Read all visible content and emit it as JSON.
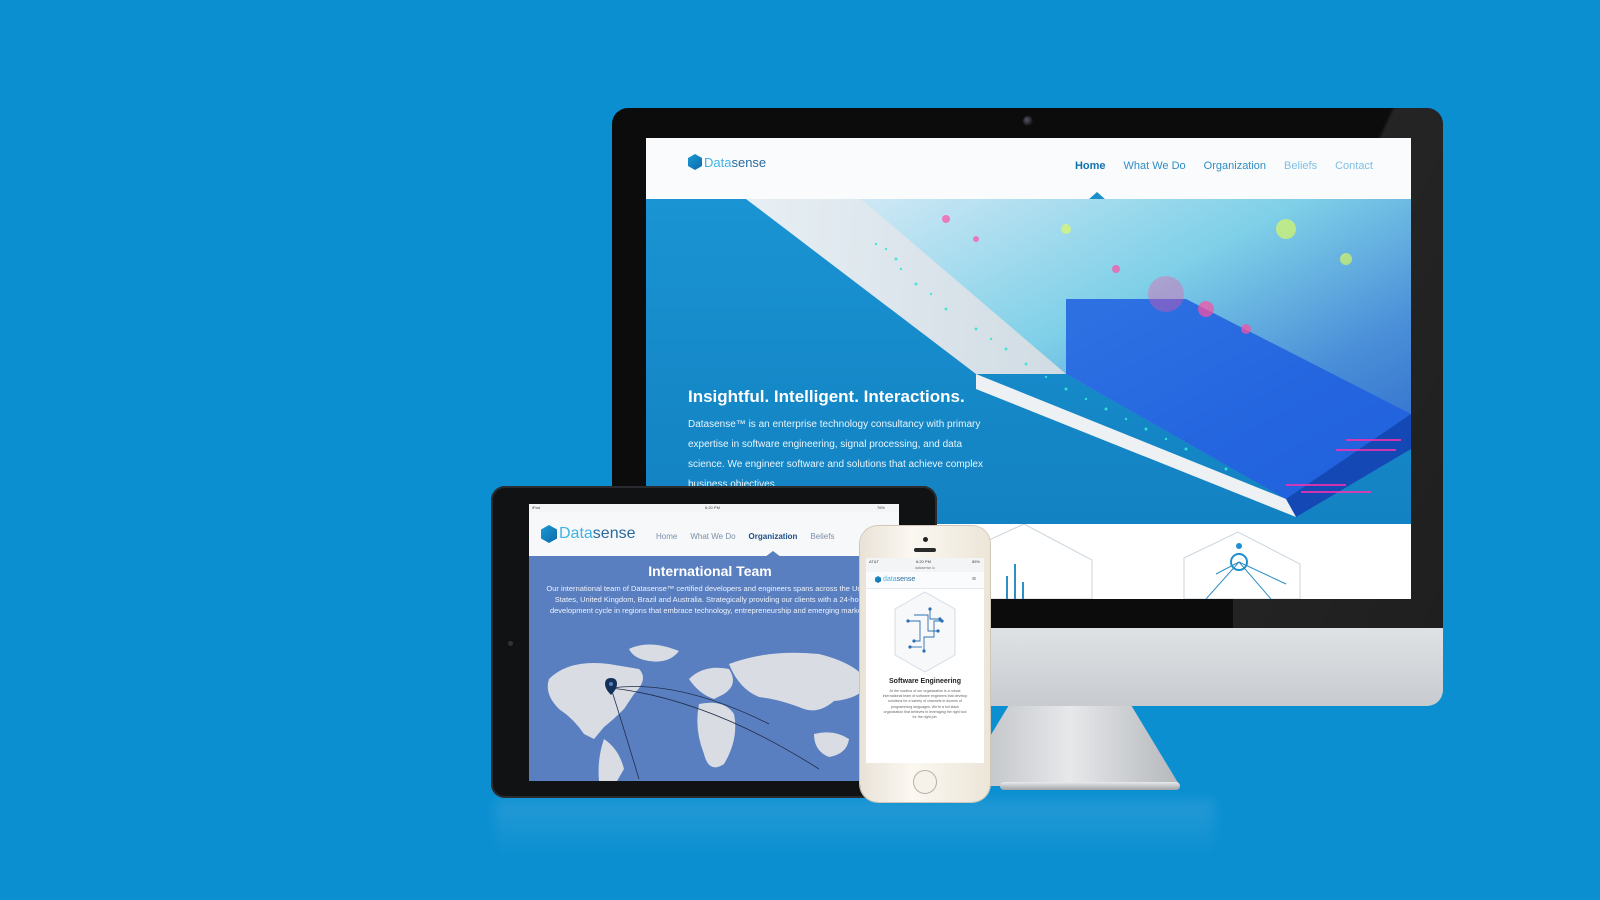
{
  "desktop": {
    "logo": {
      "data": "Data",
      "sense": "sense"
    },
    "nav": [
      {
        "label": "Home",
        "state": "active"
      },
      {
        "label": "What We Do",
        "state": "normal"
      },
      {
        "label": "Organization",
        "state": "normal"
      },
      {
        "label": "Beliefs",
        "state": "faded"
      },
      {
        "label": "Contact",
        "state": "faded"
      }
    ],
    "hero": {
      "title": "Insightful. Intelligent. Interactions.",
      "body": "Datasense™ is an enterprise technology consultancy with primary expertise in software engineering, signal processing, and data science. We engineer software and solutions that achieve complex business objectives."
    }
  },
  "tablet": {
    "status": {
      "device": "iPad",
      "time": "6:20 PM",
      "battery": "76%"
    },
    "logo": {
      "data": "Data",
      "sense": "sense"
    },
    "nav": [
      {
        "label": "Home",
        "state": "normal"
      },
      {
        "label": "What We Do",
        "state": "normal"
      },
      {
        "label": "Organization",
        "state": "active"
      },
      {
        "label": "Beliefs",
        "state": "normal"
      }
    ],
    "title": "International Team",
    "body": "Our international team of Datasense™ certified developers and engineers spans across the United States, United Kingdom, Brazil and Australia. Strategically providing our clients with a 24-hour development cycle in regions that embrace technology, entrepreneurship and emerging markets."
  },
  "phone": {
    "status": {
      "carrier": "AT&T",
      "time": "6:20 PM",
      "battery": "85%"
    },
    "url": "datasense.io",
    "logo": {
      "data": "data",
      "sense": "sense"
    },
    "menu_icon": "≡",
    "title": "Software Engineering",
    "body": "At the nucleus of our organization is a robust international team of software engineers that develop solutions for a variety of channels in dozens of programming languages. We're a full stack organization that believes in leveraging the right tool for the right job."
  },
  "colors": {
    "background": "#0b8fd1",
    "brand_light": "#41b3e6",
    "brand_dark": "#2a6a9c",
    "tablet_bg": "#5a7fc1"
  }
}
